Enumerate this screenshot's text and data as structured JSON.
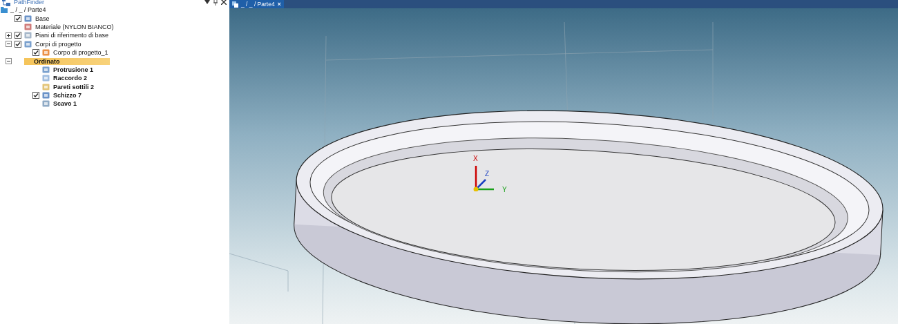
{
  "pathfinder": {
    "title": "PathFinder"
  },
  "tree": {
    "label": "_ / _ / Parte4",
    "children": [
      {
        "label": "Base",
        "kind": "check",
        "checked": true,
        "bold": false,
        "selected": false
      },
      {
        "label": "Materiale (NYLON BIANCO)",
        "kind": "plain",
        "bold": false,
        "selected": false
      },
      {
        "label": "Piani di riferimento di base",
        "kind": "check",
        "checked": true,
        "expanded": false,
        "bold": false,
        "selected": false
      },
      {
        "label": "Corpi di progetto",
        "kind": "check",
        "checked": true,
        "expanded": true,
        "bold": false,
        "selected": false,
        "children": [
          {
            "label": "Corpo di progetto_1",
            "kind": "check",
            "checked": true,
            "bold": false,
            "selected": false
          }
        ]
      },
      {
        "label": "Ordinato",
        "kind": "plain",
        "expanded": true,
        "bold": true,
        "selected": true,
        "children": [
          {
            "label": "Protrusione 1",
            "kind": "plain",
            "bold": true,
            "selected": false
          },
          {
            "label": "Raccordo 2",
            "kind": "plain",
            "bold": true,
            "selected": false
          },
          {
            "label": "Pareti sottili 2",
            "kind": "plain",
            "bold": true,
            "selected": false
          },
          {
            "label": "Schizzo 7",
            "kind": "check",
            "checked": true,
            "bold": true,
            "selected": false
          },
          {
            "label": "Scavo 1",
            "kind": "plain",
            "bold": true,
            "selected": false
          }
        ]
      }
    ]
  },
  "document_tab": {
    "label": "_ / _ / Parte4",
    "close": "×"
  },
  "triad": {
    "x": "X",
    "y": "Y",
    "z": "Z"
  }
}
